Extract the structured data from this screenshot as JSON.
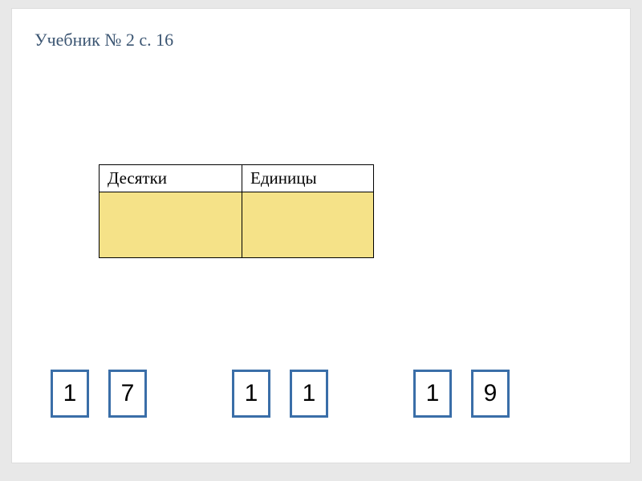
{
  "reference_text": "Учебник № 2 с. 16",
  "table": {
    "headers": {
      "tens": "Десятки",
      "units": "Единицы"
    },
    "rows": [
      {
        "tens": "",
        "units": ""
      }
    ]
  },
  "number_cards": [
    {
      "digits": [
        "1",
        "7"
      ]
    },
    {
      "digits": [
        "1",
        "1"
      ]
    },
    {
      "digits": [
        "1",
        "9"
      ]
    }
  ],
  "colors": {
    "accent_blue": "#3a6ea8",
    "cell_yellow": "#f5e288",
    "title_gray": "#3b5572"
  }
}
